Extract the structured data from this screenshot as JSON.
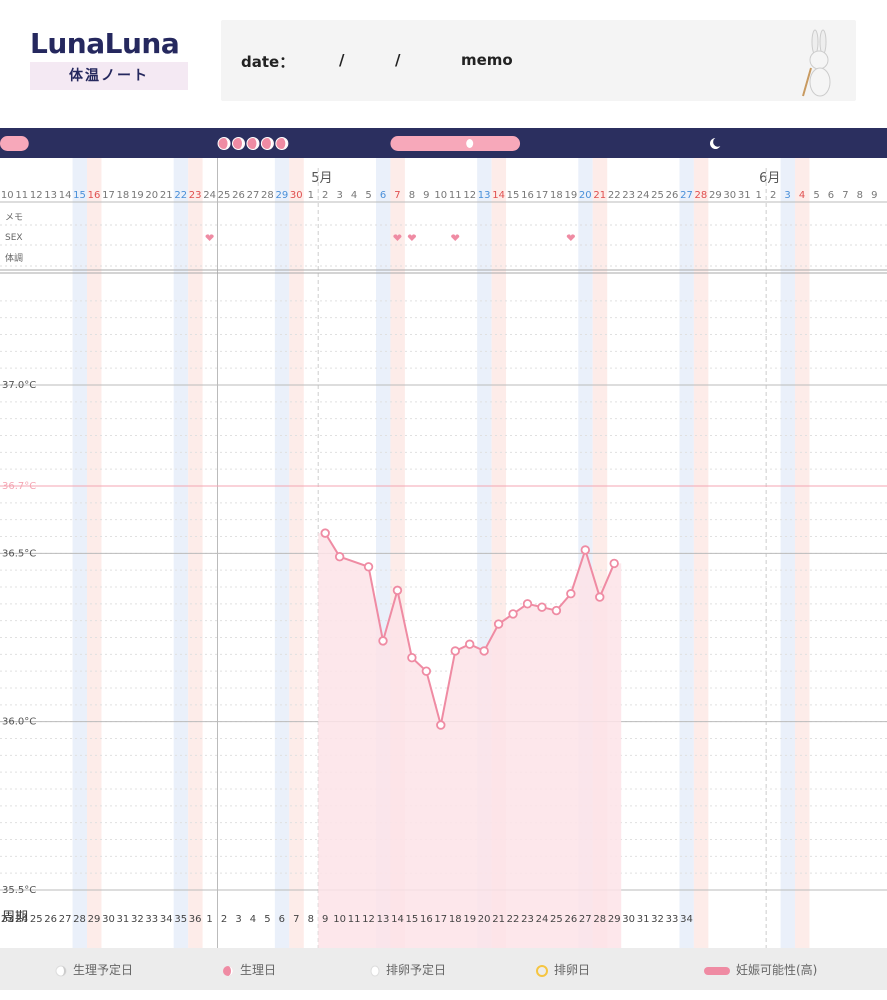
{
  "header": {
    "logo": "LunaLuna",
    "subtitle": "体温ノート",
    "date_label": "date：",
    "slash1": "/",
    "slash2": "/",
    "memo_label": "memo"
  },
  "colors": {
    "navy": "#2b2f5f",
    "pink": "#ef8ba3",
    "pink_fill": "#fde3e8",
    "blue_band": "#eaf0fa",
    "red_band": "#fdece9",
    "ref_line": "#f4a6b3"
  },
  "chart_data": {
    "type": "line",
    "ylabel": "",
    "y_ticks": [
      "37.0°C",
      "36.7°C",
      "36.5°C",
      "36.0°C",
      "35.5°C"
    ],
    "ylim": [
      35.5,
      37.0
    ],
    "reference_line": {
      "label": "36.7°C",
      "value": 36.7
    },
    "row_labels": [
      "メモ",
      "SEX",
      "体調"
    ],
    "cycle_label": "周期",
    "month_labels": [
      {
        "label": "5月",
        "at_index": 22
      },
      {
        "label": "6月",
        "at_index": 53
      }
    ],
    "days": [
      {
        "d": "10",
        "c": "23",
        "w": ""
      },
      {
        "d": "11",
        "c": "24",
        "w": ""
      },
      {
        "d": "12",
        "c": "25",
        "w": ""
      },
      {
        "d": "13",
        "c": "26",
        "w": ""
      },
      {
        "d": "14",
        "c": "27",
        "w": ""
      },
      {
        "d": "15",
        "c": "28",
        "w": "sat"
      },
      {
        "d": "16",
        "c": "29",
        "w": "sun"
      },
      {
        "d": "17",
        "c": "30",
        "w": ""
      },
      {
        "d": "18",
        "c": "31",
        "w": ""
      },
      {
        "d": "19",
        "c": "32",
        "w": ""
      },
      {
        "d": "20",
        "c": "33",
        "w": ""
      },
      {
        "d": "21",
        "c": "34",
        "w": ""
      },
      {
        "d": "22",
        "c": "35",
        "w": "sat"
      },
      {
        "d": "23",
        "c": "36",
        "w": "sun"
      },
      {
        "d": "24",
        "c": "1",
        "w": ""
      },
      {
        "d": "25",
        "c": "2",
        "w": ""
      },
      {
        "d": "26",
        "c": "3",
        "w": ""
      },
      {
        "d": "27",
        "c": "4",
        "w": ""
      },
      {
        "d": "28",
        "c": "5",
        "w": ""
      },
      {
        "d": "29",
        "c": "6",
        "w": "sat"
      },
      {
        "d": "30",
        "c": "7",
        "w": "sun"
      },
      {
        "d": "1",
        "c": "8",
        "w": ""
      },
      {
        "d": "2",
        "c": "9",
        "w": ""
      },
      {
        "d": "3",
        "c": "10",
        "w": ""
      },
      {
        "d": "4",
        "c": "11",
        "w": ""
      },
      {
        "d": "5",
        "c": "12",
        "w": ""
      },
      {
        "d": "6",
        "c": "13",
        "w": "sat"
      },
      {
        "d": "7",
        "c": "14",
        "w": "sun"
      },
      {
        "d": "8",
        "c": "15",
        "w": ""
      },
      {
        "d": "9",
        "c": "16",
        "w": ""
      },
      {
        "d": "10",
        "c": "17",
        "w": ""
      },
      {
        "d": "11",
        "c": "18",
        "w": ""
      },
      {
        "d": "12",
        "c": "19",
        "w": ""
      },
      {
        "d": "13",
        "c": "20",
        "w": "sat"
      },
      {
        "d": "14",
        "c": "21",
        "w": "sun"
      },
      {
        "d": "15",
        "c": "22",
        "w": ""
      },
      {
        "d": "16",
        "c": "23",
        "w": ""
      },
      {
        "d": "17",
        "c": "24",
        "w": ""
      },
      {
        "d": "18",
        "c": "25",
        "w": ""
      },
      {
        "d": "19",
        "c": "26",
        "w": ""
      },
      {
        "d": "20",
        "c": "27",
        "w": "sat"
      },
      {
        "d": "21",
        "c": "28",
        "w": "sun"
      },
      {
        "d": "22",
        "c": "29",
        "w": ""
      },
      {
        "d": "23",
        "c": "30",
        "w": ""
      },
      {
        "d": "24",
        "c": "31",
        "w": ""
      },
      {
        "d": "25",
        "c": "32",
        "w": ""
      },
      {
        "d": "26",
        "c": "33",
        "w": ""
      },
      {
        "d": "27",
        "c": "34",
        "w": "sat"
      },
      {
        "d": "28",
        "c": "",
        "w": "sun"
      },
      {
        "d": "29",
        "c": "",
        "w": ""
      },
      {
        "d": "30",
        "c": "",
        "w": ""
      },
      {
        "d": "31",
        "c": "",
        "w": ""
      },
      {
        "d": "1",
        "c": "",
        "w": ""
      },
      {
        "d": "2",
        "c": "",
        "w": ""
      },
      {
        "d": "3",
        "c": "",
        "w": "sat"
      },
      {
        "d": "4",
        "c": "",
        "w": "sun"
      },
      {
        "d": "5",
        "c": "",
        "w": ""
      },
      {
        "d": "6",
        "c": "",
        "w": ""
      },
      {
        "d": "7",
        "c": "",
        "w": ""
      },
      {
        "d": "8",
        "c": "",
        "w": ""
      },
      {
        "d": "9",
        "c": "",
        "w": ""
      }
    ],
    "series": [
      {
        "points": [
          {
            "i": 22,
            "y": 36.56
          },
          {
            "i": 23,
            "y": 36.49
          },
          {
            "i": 25,
            "y": 36.46
          },
          {
            "i": 26,
            "y": 36.24
          },
          {
            "i": 27,
            "y": 36.39
          },
          {
            "i": 28,
            "y": 36.19
          },
          {
            "i": 29,
            "y": 36.15
          },
          {
            "i": 30,
            "y": 35.99
          },
          {
            "i": 31,
            "y": 36.21
          },
          {
            "i": 32,
            "y": 36.23
          },
          {
            "i": 33,
            "y": 36.21
          },
          {
            "i": 34,
            "y": 36.29
          },
          {
            "i": 35,
            "y": 36.32
          },
          {
            "i": 36,
            "y": 36.35
          },
          {
            "i": 37,
            "y": 36.34
          },
          {
            "i": 38,
            "y": 36.33
          },
          {
            "i": 39,
            "y": 36.38
          },
          {
            "i": 40,
            "y": 36.51
          },
          {
            "i": 41,
            "y": 36.37
          },
          {
            "i": 42,
            "y": 36.47
          }
        ]
      }
    ],
    "sex_days": [
      14,
      27,
      28,
      31,
      39
    ],
    "period_fill_range": [
      22,
      42
    ],
    "top_bar": {
      "pregnancy_bar_ranges": [
        [
          -1,
          1
        ],
        [
          27,
          35
        ]
      ],
      "period_icon_days": [
        15,
        16,
        17,
        18,
        19
      ],
      "ovulation_predicted_day": 32,
      "period_predicted_day": 49
    }
  },
  "legend": [
    {
      "icon": "period-predicted-icon",
      "label": "生理予定日"
    },
    {
      "icon": "period-day-icon",
      "label": "生理日"
    },
    {
      "icon": "ovulation-predicted-icon",
      "label": "排卵予定日"
    },
    {
      "icon": "ovulation-day-icon",
      "label": "排卵日"
    },
    {
      "icon": "fertile-high-icon",
      "label": "妊娠可能性(高)"
    }
  ]
}
